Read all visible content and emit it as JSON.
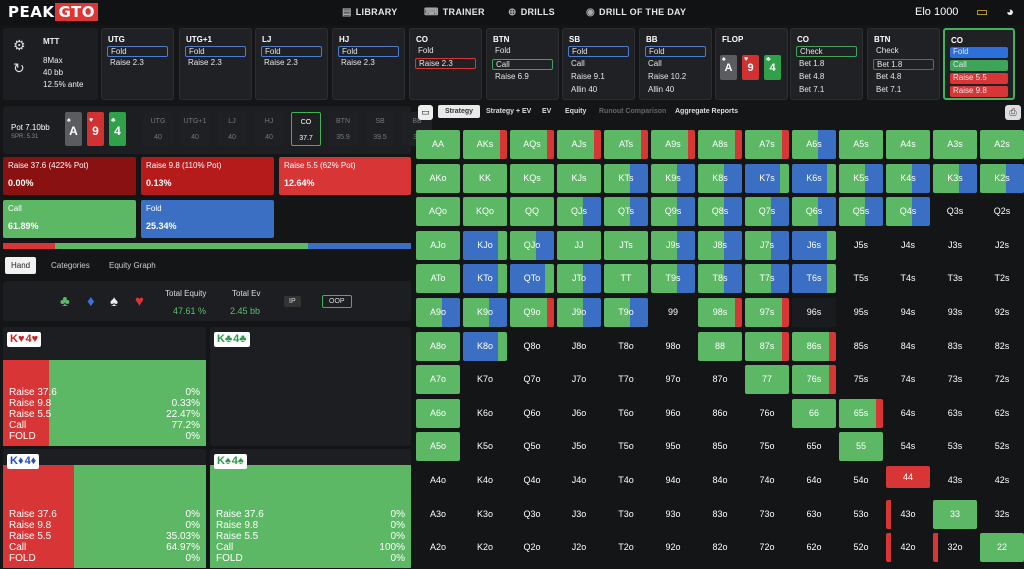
{
  "brand": {
    "name_a": "PEAK",
    "name_b": "GTO"
  },
  "nav": [
    "LIBRARY",
    "TRAINER",
    "DRILLS",
    "DRILL OF THE DAY"
  ],
  "elo": "Elo 1000",
  "config": {
    "game": "MTT",
    "table": "8Max",
    "stack": "40 bb",
    "ante": "12.5% ante"
  },
  "positions": [
    {
      "name": "UTG",
      "size": "40",
      "actions": [
        "Fold",
        "Raise 2.3"
      ],
      "sel": 0,
      "style": "sel"
    },
    {
      "name": "UTG+1",
      "size": "40",
      "actions": [
        "Fold",
        "Raise 2.3"
      ],
      "sel": 0,
      "style": "sel"
    },
    {
      "name": "LJ",
      "size": "40",
      "actions": [
        "Fold",
        "Raise 2.3"
      ],
      "sel": 0,
      "style": "sel"
    },
    {
      "name": "HJ",
      "size": "40",
      "actions": [
        "Fold",
        "Raise 2.3"
      ],
      "sel": 0,
      "style": "sel"
    },
    {
      "name": "CO",
      "size": "37.7",
      "actions": [
        "Fold",
        "Raise 2.3"
      ],
      "sel": 1,
      "style": "selr"
    },
    {
      "name": "BTN",
      "size": "35.9",
      "actions": [
        "Fold",
        "Call",
        "Raise 6.9"
      ],
      "sel": 1,
      "style": "selg"
    },
    {
      "name": "SB",
      "size": "39.5",
      "actions": [
        "Fold",
        "Call",
        "Raise 9.1",
        "Allin 40"
      ],
      "sel": 0,
      "style": "sel"
    },
    {
      "name": "BB",
      "size": "39",
      "actions": [
        "Fold",
        "Call",
        "Raise 10.2",
        "Allin 40"
      ],
      "sel": 0,
      "style": "sel"
    },
    {
      "name": "FLOP",
      "size": "",
      "actions": [],
      "sel": -1,
      "style": ""
    },
    {
      "name": "CO",
      "size": "37.7",
      "actions": [
        "Check",
        "Bet 1.8",
        "Bet 4.8",
        "Bet 7.1"
      ],
      "sel": 0,
      "style": "selg"
    },
    {
      "name": "BTN",
      "size": "35.9",
      "actions": [
        "Check",
        "Bet 1.8",
        "Bet 4.8",
        "Bet 7.1"
      ],
      "sel": 1,
      "style": "selr"
    },
    {
      "name": "CO",
      "size": "37.7",
      "actions": [
        "Fold",
        "Call",
        "Raise 5.5",
        "Raise 9.8"
      ],
      "sel": -1,
      "style": "active"
    }
  ],
  "flop": [
    {
      "rank": "A",
      "suit": "♠"
    },
    {
      "rank": "9",
      "suit": "♥"
    },
    {
      "rank": "4",
      "suit": "♣"
    }
  ],
  "pot": {
    "label": "Pot",
    "value": "7.10bb",
    "spr": "SPR: 5.31"
  },
  "seats": [
    {
      "n": "UTG",
      "v": "40"
    },
    {
      "n": "UTG+1",
      "v": "40"
    },
    {
      "n": "LJ",
      "v": "40"
    },
    {
      "n": "HJ",
      "v": "40"
    },
    {
      "n": "CO",
      "v": "37.7"
    },
    {
      "n": "BTN",
      "v": "35.9"
    },
    {
      "n": "SB",
      "v": "39.5"
    },
    {
      "n": "BB",
      "v": "39"
    }
  ],
  "responses": [
    {
      "label": "Raise 37.6 (422% Pot)",
      "value": "0.00%",
      "color": "#8a1111"
    },
    {
      "label": "Raise 9.8 (110% Pot)",
      "value": "0.13%",
      "color": "#b51b1b"
    },
    {
      "label": "Raise 5.5 (62% Pot)",
      "value": "12.64%",
      "color": "#d83636"
    },
    {
      "label": "Call",
      "value": "61.89%",
      "color": "#5cb865"
    },
    {
      "label": "Fold",
      "value": "25.34%",
      "color": "#3b6fc4"
    }
  ],
  "freq_bar": [
    {
      "pct": 12.8,
      "color": "#d83636"
    },
    {
      "pct": 61.9,
      "color": "#5cb865"
    },
    {
      "pct": 25.3,
      "color": "#3b6fc4"
    }
  ],
  "tabs": [
    "Hand",
    "Categories",
    "Equity Graph"
  ],
  "equity": {
    "total_equity_label": "Total Equity",
    "total_equity": "47.61 %",
    "total_ev_label": "Total Ev",
    "total_ev": "2.45 bb",
    "ip": "IP",
    "oop": "OOP"
  },
  "hands": [
    {
      "card1": "K♥",
      "card2": "4♥",
      "red": true,
      "rows": [
        [
          "Raise 37.6",
          "0%"
        ],
        [
          "Raise 9.8",
          "0.33%"
        ],
        [
          "Raise 5.5",
          "22.47%"
        ],
        [
          "Call",
          "77.2%"
        ],
        [
          "FOLD",
          "0%"
        ]
      ],
      "raise": 0.228,
      "call": 0.772
    },
    {
      "card1": "K♣",
      "card2": "4♣",
      "red": false,
      "rows": [],
      "raise": 0,
      "call": 0
    },
    {
      "card1": "K♦",
      "card2": "4♦",
      "red": false,
      "blue": true,
      "rows": [
        [
          "Raise 37.6",
          "0%"
        ],
        [
          "Raise 9.8",
          "0%"
        ],
        [
          "Raise 5.5",
          "35.03%"
        ],
        [
          "Call",
          "64.97%"
        ],
        [
          "FOLD",
          "0%"
        ]
      ],
      "raise": 0.35,
      "call": 0.65
    },
    {
      "card1": "K♠",
      "card2": "4♠",
      "red": false,
      "rows": [
        [
          "Raise 37.6",
          "0%"
        ],
        [
          "Raise 9.8",
          "0%"
        ],
        [
          "Raise 5.5",
          "0%"
        ],
        [
          "Call",
          "100%"
        ],
        [
          "FOLD",
          "0%"
        ]
      ],
      "raise": 0,
      "call": 1
    }
  ],
  "matrix_tabs": [
    "Strategy",
    "Strategy + EV",
    "EV",
    "Equity",
    "Runout Comparison",
    "Aggregate Reports"
  ],
  "matrix": [
    [
      "AA",
      "AKs",
      "AQs",
      "AJs",
      "ATs",
      "A9s",
      "A8s",
      "A7s",
      "A6s",
      "A5s",
      "A4s",
      "A3s",
      "A2s"
    ],
    [
      "AKo",
      "KK",
      "KQs",
      "KJs",
      "KTs",
      "K9s",
      "K8s",
      "K7s",
      "K6s",
      "K5s",
      "K4s",
      "K3s",
      "K2s"
    ],
    [
      "AQo",
      "KQo",
      "QQ",
      "QJs",
      "QTs",
      "Q9s",
      "Q8s",
      "Q7s",
      "Q6s",
      "Q5s",
      "Q4s",
      "Q3s",
      "Q2s"
    ],
    [
      "AJo",
      "KJo",
      "QJo",
      "JJ",
      "JTs",
      "J9s",
      "J8s",
      "J7s",
      "J6s",
      "J5s",
      "J4s",
      "J3s",
      "J2s"
    ],
    [
      "ATo",
      "KTo",
      "QTo",
      "JTo",
      "TT",
      "T9s",
      "T8s",
      "T7s",
      "T6s",
      "T5s",
      "T4s",
      "T3s",
      "T2s"
    ],
    [
      "A9o",
      "K9o",
      "Q9o",
      "J9o",
      "T9o",
      "99",
      "98s",
      "97s",
      "96s",
      "95s",
      "94s",
      "93s",
      "92s"
    ],
    [
      "A8o",
      "K8o",
      "Q8o",
      "J8o",
      "T8o",
      "98o",
      "88",
      "87s",
      "86s",
      "85s",
      "84s",
      "83s",
      "82s"
    ],
    [
      "A7o",
      "K7o",
      "Q7o",
      "J7o",
      "T7o",
      "97o",
      "87o",
      "77",
      "76s",
      "75s",
      "74s",
      "73s",
      "72s"
    ],
    [
      "A6o",
      "K6o",
      "Q6o",
      "J6o",
      "T6o",
      "96o",
      "86o",
      "76o",
      "66",
      "65s",
      "64s",
      "63s",
      "62s"
    ],
    [
      "A5o",
      "K5o",
      "Q5o",
      "J5o",
      "T5o",
      "95o",
      "85o",
      "75o",
      "65o",
      "55",
      "54s",
      "53s",
      "52s"
    ],
    [
      "A4o",
      "K4o",
      "Q4o",
      "J4o",
      "T4o",
      "94o",
      "84o",
      "74o",
      "64o",
      "54o",
      "44",
      "43s",
      "42s"
    ],
    [
      "A3o",
      "K3o",
      "Q3o",
      "J3o",
      "T3o",
      "93o",
      "83o",
      "73o",
      "63o",
      "53o",
      "43o",
      "33",
      "32s"
    ],
    [
      "A2o",
      "K2o",
      "Q2o",
      "J2o",
      "T2o",
      "92o",
      "82o",
      "72o",
      "62o",
      "52o",
      "42o",
      "32o",
      "22"
    ]
  ],
  "matrix_fill": [
    [
      "g",
      "gr",
      "gr",
      "gr",
      "gr",
      "gr",
      "gr",
      "gr",
      "gb",
      "g",
      "g",
      "g",
      "g"
    ],
    [
      "g",
      "g",
      "g",
      "g",
      "gb",
      "gb",
      "gb",
      "b",
      "b",
      "gb",
      "gb",
      "gb",
      "gb"
    ],
    [
      "g",
      "g",
      "g",
      "gb",
      "gb",
      "gb",
      "gb",
      "gb",
      "gb",
      "gb",
      "gb",
      "n",
      "n"
    ],
    [
      "g",
      "b",
      "gb",
      "g",
      "g",
      "gb",
      "gb",
      "gb",
      "b",
      "n",
      "n",
      "n",
      "n"
    ],
    [
      "g",
      "b",
      "b",
      "gb",
      "g",
      "gb",
      "gb",
      "gb",
      "b",
      "n",
      "n",
      "n",
      "n"
    ],
    [
      "gb",
      "gb",
      "gr",
      "gb",
      "gb",
      "n",
      "gr",
      "gr",
      "rl",
      "n",
      "n",
      "n",
      "n"
    ],
    [
      "g",
      "b",
      "n",
      "n",
      "n",
      "n",
      "g",
      "gr",
      "gr",
      "n",
      "n",
      "n",
      "n"
    ],
    [
      "g",
      "n",
      "n",
      "n",
      "n",
      "n",
      "n",
      "g",
      "gr",
      "n",
      "n",
      "n",
      "n"
    ],
    [
      "g",
      "n",
      "n",
      "n",
      "n",
      "n",
      "n",
      "n",
      "g",
      "gr",
      "n",
      "n",
      "n"
    ],
    [
      "g",
      "n",
      "n",
      "n",
      "n",
      "n",
      "n",
      "n",
      "n",
      "g",
      "n",
      "n",
      "n"
    ],
    [
      "n",
      "n",
      "n",
      "n",
      "n",
      "n",
      "n",
      "n",
      "n",
      "n",
      "r",
      "n",
      "n"
    ],
    [
      "n",
      "n",
      "n",
      "n",
      "n",
      "n",
      "n",
      "n",
      "n",
      "n",
      "rs",
      "g",
      "n"
    ],
    [
      "n",
      "n",
      "n",
      "n",
      "n",
      "n",
      "n",
      "n",
      "n",
      "n",
      "rs",
      "rs",
      "g"
    ]
  ]
}
